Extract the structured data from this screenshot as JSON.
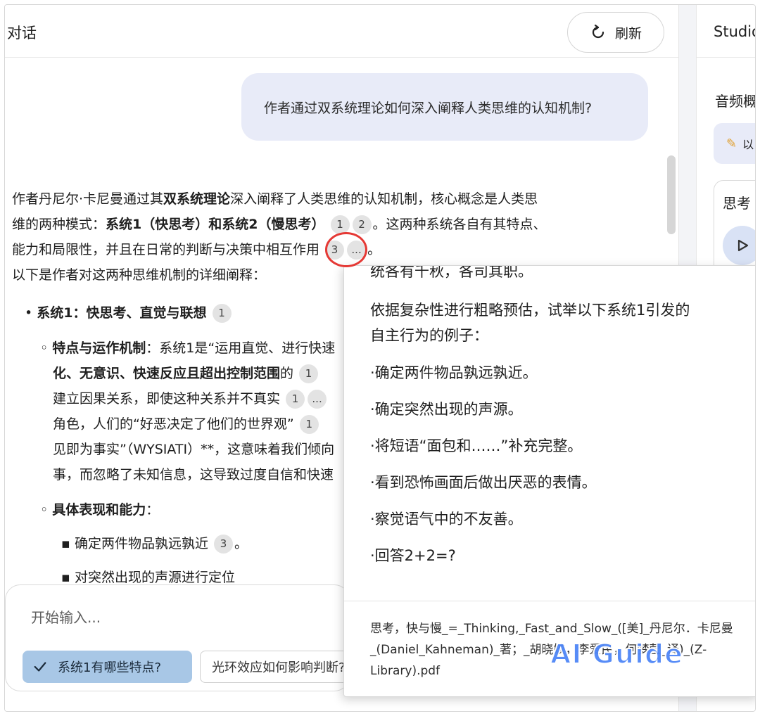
{
  "chat": {
    "title": "对话",
    "refresh_label": "刷新",
    "user_question": "作者通过双系统理论如何深入阐释人类思维的认知机制?",
    "answer": {
      "p1_a": "作者丹尼尔·卡尼曼通过其",
      "p1_b": "双系统理论",
      "p1_c": "深入阐释了人类思维的认知机制，核心概念是人类思",
      "p1_d": "维的两种模式：",
      "p1_e": "系统1（快思考）和系统2（慢思考）",
      "p1_f": "。这两种系统各自有其特点、",
      "p1_g": "能力和局限性，并且在日常的判断与决策中相互作用",
      "p1_h": "。",
      "p2": "以下是作者对这两种思维机制的详细阐释：",
      "b1": "系统1：快思考、直觉与联想",
      "b2_label": "特点与运作机制",
      "b2_a": "：系统1是“运用直觉、进行快速",
      "b2_b": "化、无意识、快速反应且超出控制范围",
      "b2_c": "的",
      "b2_d": "建立因果关系，即使这种关系并不真实",
      "b2_e": "角色，人们的“好恶决定了他们的世界观”",
      "b2_f": "见即为事实”（WYSIATI）**，这意味着我们倾向",
      "b2_g": "事，而忽略了未知信息，这导致过度自信和快速",
      "b3_label": "具体表现和能力",
      "b3_colon": "：",
      "b4": "确定两件物品孰远孰近",
      "b4_end": "。",
      "b5": "对突然出现的声源进行定位"
    },
    "citations": {
      "c1": "1",
      "c2": "2",
      "c3": "3",
      "more": "..."
    },
    "input_placeholder": "开始输入...",
    "suggestions": [
      "系统1有哪些特点?",
      "光环效应如何影响判断?"
    ]
  },
  "studio": {
    "title": "Studio",
    "audio_overview": "音频概览",
    "audio_card_text": "以",
    "think_card_title": "思考"
  },
  "popover": {
    "lines": [
      "统各有千秋，各司其职。",
      "依据复杂性进行粗略预估，试举以下系统1引发的",
      "自主行为的例子：",
      "·确定两件物品孰远孰近。",
      "·确定突然出现的声源。",
      "·将短语“面包和……”补充完整。",
      "·看到恐怖画面后做出厌恶的表情。",
      "·察觉语气中的不友善。",
      "·回答2+2=?"
    ],
    "source": "思考，快与慢_=_Thinking,_Fast_and_Slow_([美]_丹尼尔．卡尼曼_(Daniel_Kahneman)_著；_胡晓姣，李爱民，何梦莹_译)_(Z-Library).pdf"
  },
  "watermark": "AI Guide",
  "colors": {
    "user_bubble": "#e8ebf8",
    "chip_active": "#a8c7e6",
    "annotation_circle": "#e53935",
    "watermark": "#4f86f7"
  }
}
